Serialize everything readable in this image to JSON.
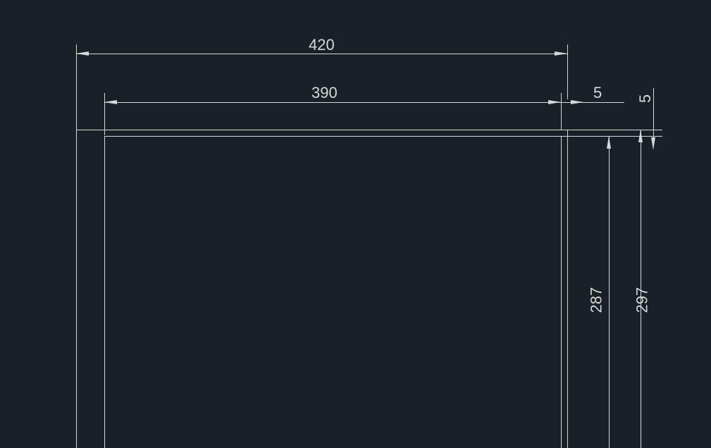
{
  "dimensions": {
    "outer_width": "420",
    "inner_width": "390",
    "offset_right": "5",
    "offset_top": "5",
    "outer_height": "297",
    "inner_height": "287"
  },
  "colors": {
    "background": "#1a2027",
    "line": "#d8d8d8"
  }
}
